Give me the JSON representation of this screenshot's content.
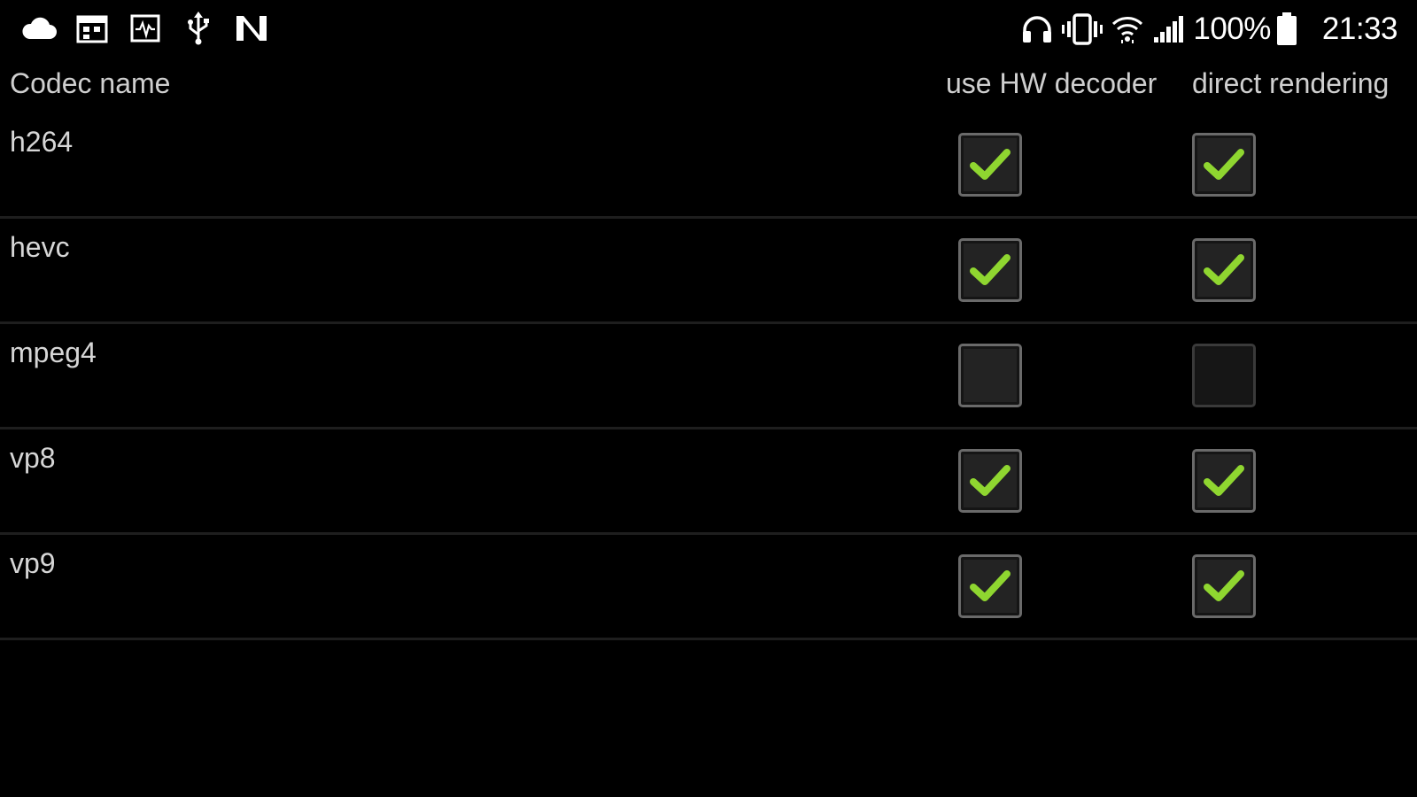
{
  "status_bar": {
    "left_icons": [
      "cloud-icon",
      "calendar-icon",
      "pulse-chart-icon",
      "usb-icon",
      "n-logo-icon"
    ],
    "right_icons": [
      "headphones-icon",
      "vibrate-icon",
      "wifi-icon",
      "cell-signal-icon",
      "battery-icon"
    ],
    "battery_percent": "100%",
    "clock": "21:33"
  },
  "table": {
    "columns": {
      "name": "Codec name",
      "hw_decoder": "use HW decoder",
      "direct_rendering": "direct rendering"
    },
    "rows": [
      {
        "codec": "h264",
        "hw_decoder": true,
        "direct_rendering": true
      },
      {
        "codec": "hevc",
        "hw_decoder": true,
        "direct_rendering": true
      },
      {
        "codec": "mpeg4",
        "hw_decoder": false,
        "direct_rendering": false
      },
      {
        "codec": "vp8",
        "hw_decoder": true,
        "direct_rendering": true
      },
      {
        "codec": "vp9",
        "hw_decoder": true,
        "direct_rendering": true
      }
    ]
  },
  "colors": {
    "background": "#000000",
    "text": "#d6d6d6",
    "check": "#8fd630",
    "checkbox_border": "#6a6a6a"
  }
}
